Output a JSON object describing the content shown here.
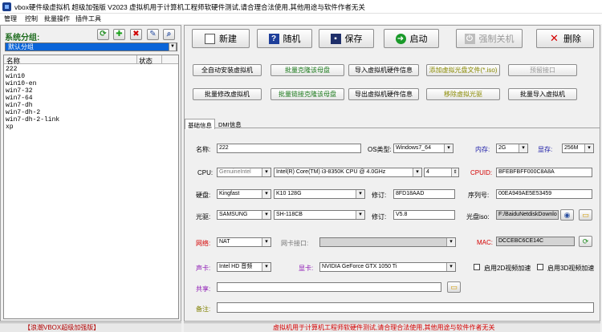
{
  "window": {
    "title": "vbox硬件级虚拟机 超级加强版 V2023 虚拟机用于计算机工程师软硬件测试,请合理合法使用,其他用途与软件作者无关"
  },
  "menu": [
    "管理",
    "控制",
    "批量操作",
    "插件工具"
  ],
  "sidebar": {
    "group_label": "系统分组:",
    "group_selected": "默认分组",
    "columns": [
      "名称",
      "状态"
    ],
    "vms": [
      "222",
      "win10",
      "win10-en",
      "win7-32",
      "win7-64",
      "win7-dh",
      "win7-dh-2",
      "win7-dh-2-link",
      "xp"
    ],
    "status_text": "【浪潮VBOX超级加强版】"
  },
  "toolbar": {
    "new": "新建",
    "random": "随机",
    "save": "保存",
    "start": "启动",
    "force_off": "强制关机",
    "delete": "删除"
  },
  "actions": {
    "row1": [
      "全自动安装虚拟机",
      "批量克隆该母盘",
      "导入虚拟机硬件信息",
      "添加虚拟光盘文件(*.iso)",
      "预留接口"
    ],
    "row2": [
      "批量修改虚拟机",
      "批量链接克隆该母盘",
      "导出虚拟机硬件信息",
      "移除虚拟光驱",
      "批量导入虚拟机"
    ]
  },
  "tabs": [
    "基础信息",
    "DMI信息"
  ],
  "form": {
    "name_label": "名称:",
    "name_value": "222",
    "os_label": "OS类型:",
    "os_value": "Windows7_64",
    "mem_label": "内存:",
    "mem_value": "2G",
    "vram_label": "显存:",
    "vram_value": "256M",
    "cpu_label": "CPU:",
    "cpu_vendor": "GenuineIntel",
    "cpu_model": "Intel(R) Core(TM) i3-8350K CPU @ 4.0GHz",
    "cpu_cores": "4",
    "cpuid_label": "CPUID:",
    "cpuid_value": "BFEBFBFF000C8A8A",
    "disk_label": "硬盘:",
    "disk_vendor": "Kingfast",
    "disk_model": "K10 128G",
    "disk_rev_label": "修订:",
    "disk_rev_value": "8FD18AAD",
    "serial_label": "序列号:",
    "serial_value": "00EA949AE5E53459",
    "cd_label": "光驱:",
    "cd_vendor": "SAMSUNG",
    "cd_model": "SH-118CB",
    "cd_rev_label": "修订:",
    "cd_rev_value": "V5.8",
    "iso_label": "光盘iso:",
    "iso_value": "F:/BaiduNetdiskDownlo",
    "net_label": "网络:",
    "net_value": "NAT",
    "nic_label": "网卡接口:",
    "nic_value": "",
    "mac_label": "MAC:",
    "mac_value": "DCCEBC6CE14C",
    "sound_label": "声卡:",
    "sound_value": "Intel HD 音频",
    "gpu_label": "显卡:",
    "gpu_value": "NVIDIA GeForce GTX 1050 Ti",
    "accel2d_label": "启用2D视频加速",
    "accel3d_label": "启用3D视频加速",
    "share_label": "共享:",
    "share_value": "",
    "note_label": "备注:",
    "note_value": ""
  },
  "footer": {
    "text": "虚拟机用于计算机工程师软硬件测试,请合理合法使用,其他用途与软件作者无关"
  },
  "colors": {
    "accent_red": "#d40000",
    "accent_green": "#1d6b1d",
    "select_blue": "#0a64d8"
  }
}
